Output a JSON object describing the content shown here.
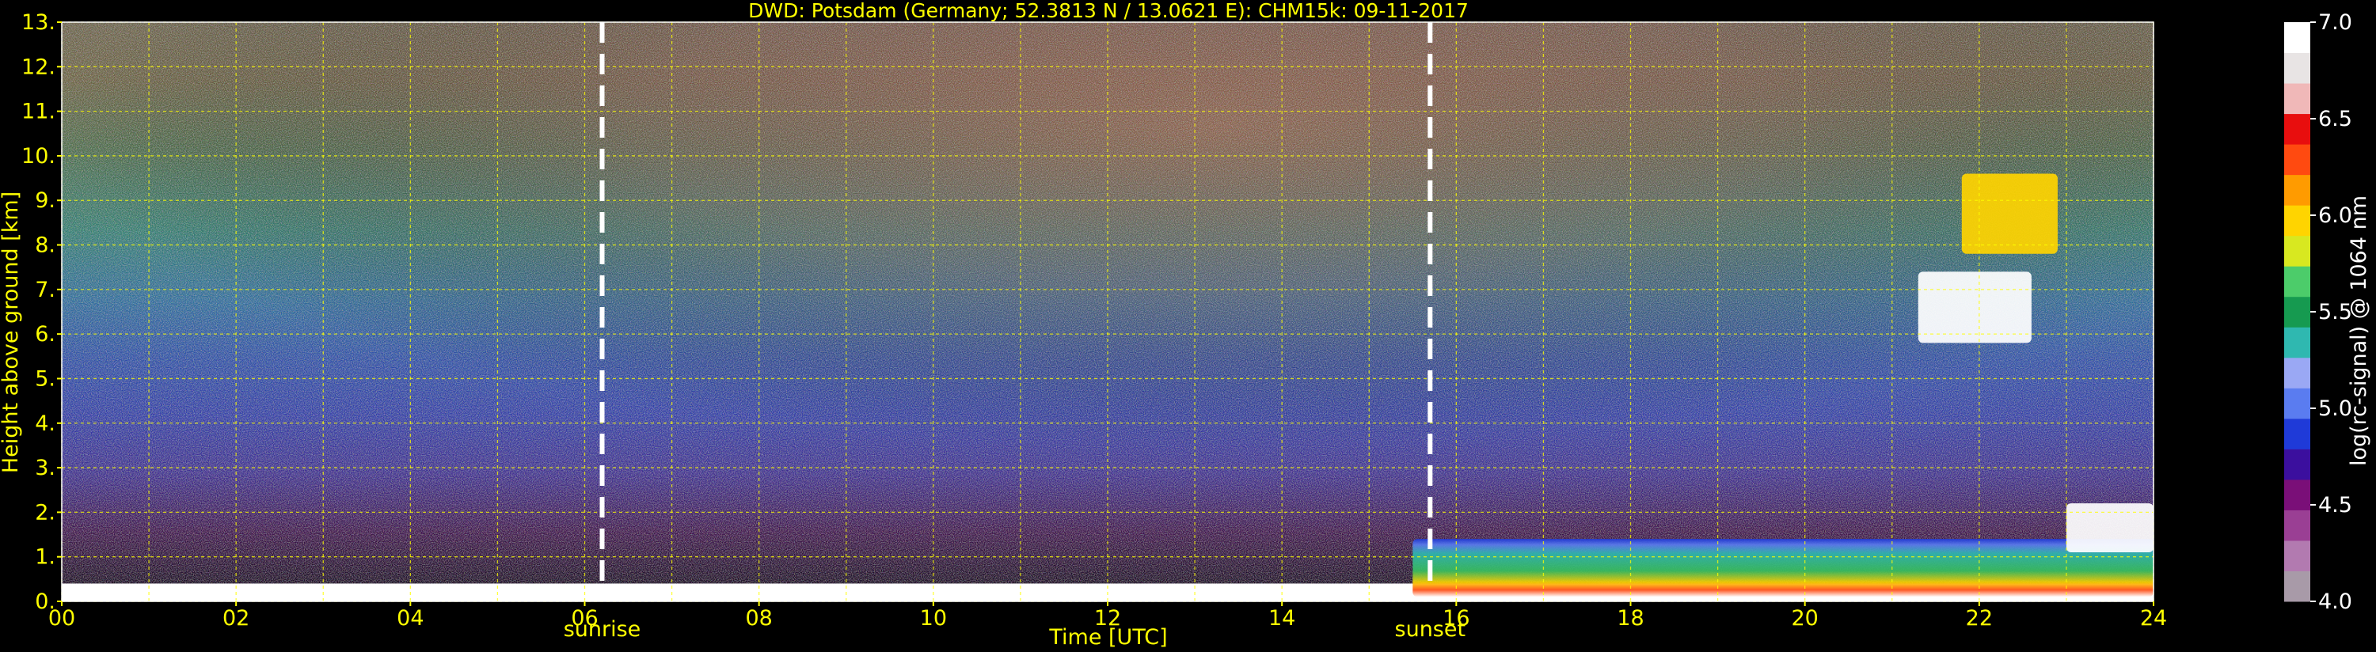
{
  "chart_data": {
    "type": "heatmap",
    "title": "DWD: Potsdam (Germany; 52.3813 N / 13.0621 E):    CHM15k: 09-11-2017",
    "xlabel": "Time [UTC]",
    "ylabel": "Height above ground [km]",
    "xlim": [
      0,
      24
    ],
    "ylim": [
      0,
      13
    ],
    "x_ticks": [
      "00",
      "02",
      "04",
      "06",
      "08",
      "10",
      "12",
      "14",
      "16",
      "18",
      "20",
      "22",
      "24"
    ],
    "y_ticks": [
      "0.",
      "1.",
      "2.",
      "3.",
      "4.",
      "5.",
      "6.",
      "7.",
      "8.",
      "9.",
      "10.",
      "11.",
      "12.",
      "13."
    ],
    "grid": true,
    "colorbar": {
      "label": "log(rc-signal) @ 1064 nm",
      "range": [
        4.0,
        7.0
      ],
      "ticks": [
        "4.0",
        "4.5",
        "5.0",
        "5.5",
        "6.0",
        "6.5",
        "7.0"
      ],
      "colors": [
        "#a89aa8",
        "#b27ab0",
        "#9a3f94",
        "#7a0f78",
        "#3b0f9e",
        "#1f3ad8",
        "#5a7cf0",
        "#9aa8f4",
        "#2fb8b0",
        "#169a50",
        "#4ccc6a",
        "#d8e820",
        "#ffd400",
        "#ff9b00",
        "#ff4a10",
        "#e80e0e",
        "#f0b8b8",
        "#e8e4e4",
        "#ffffff"
      ]
    },
    "annotations": [
      {
        "label": "sunrise",
        "x": 6.2
      },
      {
        "label": "sunset",
        "x": 15.7
      }
    ],
    "features": [
      {
        "name": "surface layer",
        "x": [
          0,
          24
        ],
        "y": [
          0.0,
          0.4
        ],
        "log_signal": 7.0
      },
      {
        "name": "boundary layer",
        "x": [
          15.5,
          24
        ],
        "y": [
          0.1,
          1.4
        ],
        "log_signal": 5.6
      },
      {
        "name": "cloud",
        "x": [
          21.3,
          22.6
        ],
        "y": [
          5.8,
          7.4
        ],
        "log_signal": 7.0
      },
      {
        "name": "cirrus",
        "x": [
          21.8,
          22.9
        ],
        "y": [
          7.8,
          9.6
        ],
        "log_signal": 6.0
      },
      {
        "name": "low cloud",
        "x": [
          23.0,
          24
        ],
        "y": [
          1.1,
          2.2
        ],
        "log_signal": 7.0
      }
    ]
  },
  "colors": {
    "text": "#ffff00",
    "grid": "#ffff00",
    "background": "#000000"
  }
}
